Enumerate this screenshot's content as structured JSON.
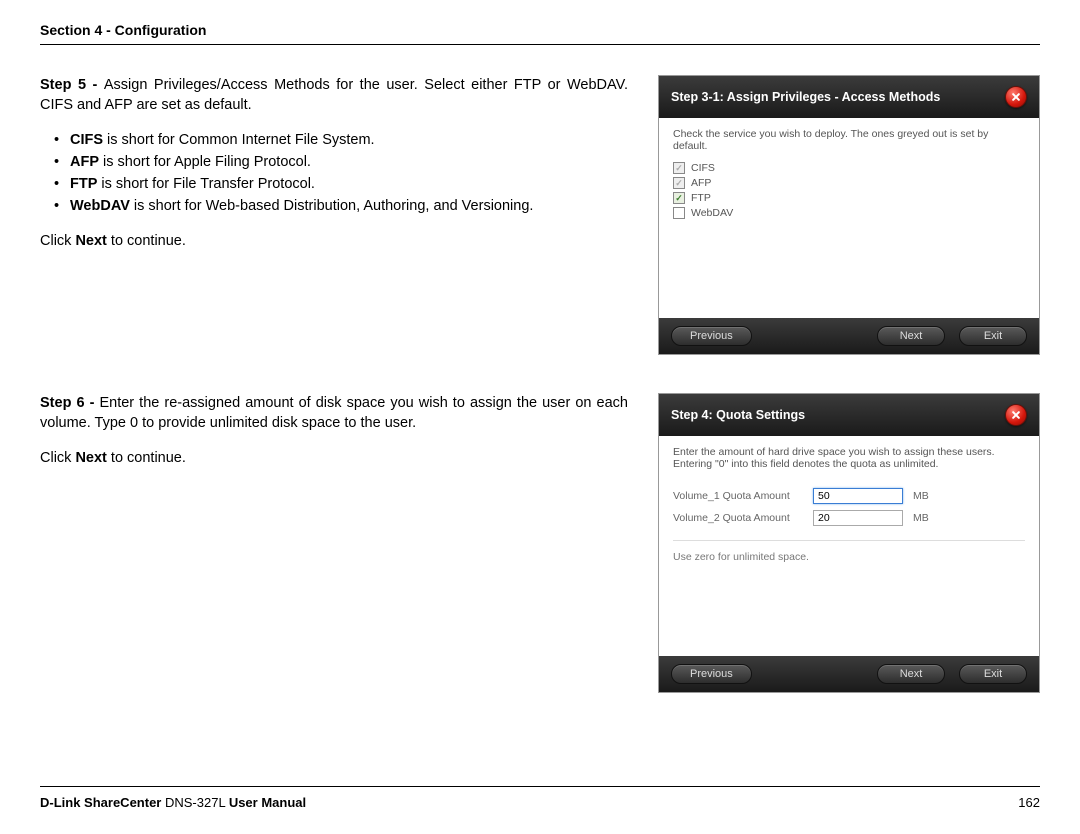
{
  "header": {
    "section": "Section 4 - Configuration"
  },
  "step5": {
    "lead_bold": "Step 5 - ",
    "lead_rest": "Assign Privileges/Access Methods for the user. Select either FTP or WebDAV. CIFS and AFP are set as default.",
    "bullets": [
      {
        "b": "CIFS",
        "t": " is short for Common Internet File System."
      },
      {
        "b": "AFP",
        "t": " is short for Apple Filing Protocol."
      },
      {
        "b": "FTP",
        "t": " is short for File Transfer Protocol."
      },
      {
        "b": "WebDAV",
        "t": " is short for Web-based Distribution, Authoring, and Versioning."
      }
    ],
    "next_pre": "Click ",
    "next_bold": "Next",
    "next_post": " to continue."
  },
  "step6": {
    "lead_bold": "Step 6 - ",
    "lead_rest": "Enter the re-assigned amount of disk space you wish to assign the user on each volume. Type 0 to provide unlimited disk space to the user.",
    "next_pre": "Click ",
    "next_bold": "Next",
    "next_post": " to continue."
  },
  "dialog1": {
    "title": "Step 3-1: Assign Privileges - Access Methods",
    "hint": "Check the service you wish to deploy. The ones greyed out is set by default.",
    "services": [
      {
        "label": "CIFS",
        "checked": true,
        "disabled": true
      },
      {
        "label": "AFP",
        "checked": true,
        "disabled": true
      },
      {
        "label": "FTP",
        "checked": true,
        "disabled": false
      },
      {
        "label": "WebDAV",
        "checked": false,
        "disabled": false
      }
    ],
    "buttons": {
      "prev": "Previous",
      "next": "Next",
      "exit": "Exit"
    }
  },
  "dialog2": {
    "title": "Step 4: Quota Settings",
    "hint": "Enter the amount of hard drive space you wish to assign these users. Entering \"0\" into this field denotes the quota as unlimited.",
    "rows": [
      {
        "label": "Volume_1 Quota Amount",
        "value": "50",
        "unit": "MB",
        "active": true
      },
      {
        "label": "Volume_2 Quota Amount",
        "value": "20",
        "unit": "MB",
        "active": false
      }
    ],
    "note": "Use zero for unlimited space.",
    "buttons": {
      "prev": "Previous",
      "next": "Next",
      "exit": "Exit"
    }
  },
  "footer": {
    "brand_bold1": "D-Link ShareCenter",
    "model": " DNS-327L ",
    "brand_bold2": "User Manual",
    "page": "162"
  }
}
